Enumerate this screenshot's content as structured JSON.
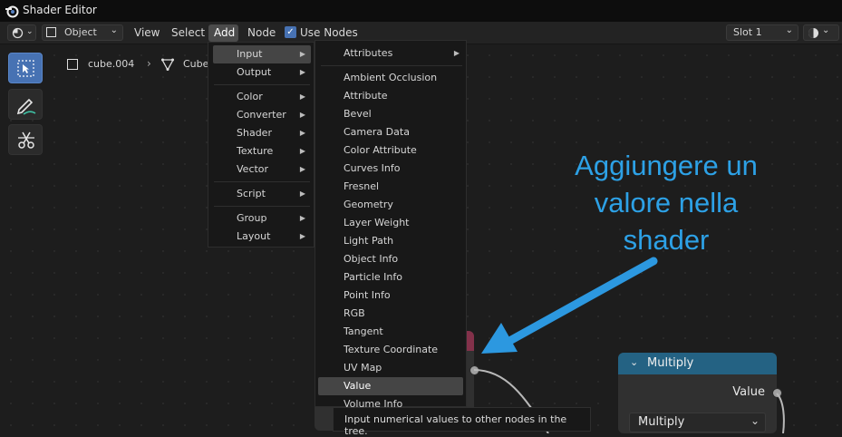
{
  "window": {
    "title": "Shader Editor"
  },
  "header": {
    "object_mode": "Object",
    "menus": [
      "View",
      "Select",
      "Add",
      "Node"
    ],
    "use_nodes_label": "Use Nodes",
    "slot": "Slot 1"
  },
  "breadcrumb": {
    "object": "cube.004",
    "mesh": "Cube"
  },
  "add_menu": {
    "items": [
      {
        "label": "Input",
        "submenu": true
      },
      {
        "label": "Output",
        "submenu": true
      },
      {
        "label": "Color",
        "submenu": true
      },
      {
        "label": "Converter",
        "submenu": true
      },
      {
        "label": "Shader",
        "submenu": true
      },
      {
        "label": "Texture",
        "submenu": true
      },
      {
        "label": "Vector",
        "submenu": true
      },
      {
        "label": "Script",
        "submenu": true
      },
      {
        "label": "Group",
        "submenu": true
      },
      {
        "label": "Layout",
        "submenu": true
      }
    ]
  },
  "input_menu": {
    "items": [
      "Attributes",
      "Ambient Occlusion",
      "Attribute",
      "Bevel",
      "Camera Data",
      "Color Attribute",
      "Curves Info",
      "Fresnel",
      "Geometry",
      "Layer Weight",
      "Light Path",
      "Object Info",
      "Particle Info",
      "Point Info",
      "RGB",
      "Tangent",
      "Texture Coordinate",
      "UV Map",
      "Value",
      "Volume Info"
    ],
    "highlighted": "Value"
  },
  "tooltip": "Input numerical values to other nodes in the tree.",
  "annotation": {
    "line1": "Aggiungere un",
    "line2": "valore nella",
    "line3": "shader"
  },
  "multiply_node": {
    "title": "Multiply",
    "output": "Value",
    "operation": "Multiply"
  },
  "colors": {
    "accent": "#4772b3",
    "annotation": "#2da1e6",
    "node_header": "#246283"
  }
}
